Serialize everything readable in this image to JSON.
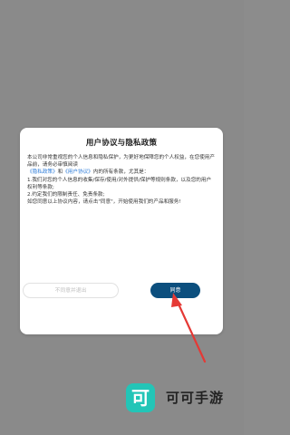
{
  "dialog": {
    "title": "用户协议与隐私政策",
    "body": {
      "line1": "本公司非常重视您的个人信息和隐私保护，为更好地保障您的个人权益，在您使用产品前，请务必审慎阅读",
      "privacy_link": "《隐私政策》",
      "and": "和",
      "user_link": "《用户协议》",
      "line2_tail": "内的所有条款，尤其是：",
      "item1": "1.我们对您的个人信息的收集/保存/使用/对外提供/保护等规则条款，以及您的用户权利等条款;",
      "item2": "2.约定我们的限制责任、免责条款;",
      "closing": "如您同意以上协议内容，请点击\"同意\"，开始使用我们的产品和服务!"
    },
    "decline_label": "不同意并退出",
    "agree_label": "同意"
  },
  "brand": {
    "logo_text": "可",
    "name": "可可手游",
    "accent": "#23c5b7"
  },
  "colors": {
    "agree_button": "#0c4f7e",
    "link": "#2a7ad8",
    "arrow": "#e53935"
  }
}
